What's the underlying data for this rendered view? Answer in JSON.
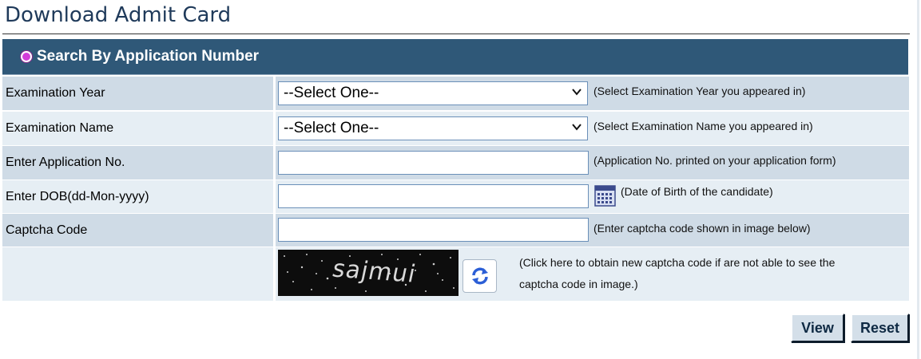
{
  "page": {
    "title": "Download Admit Card"
  },
  "search": {
    "title": "Search By Application Number",
    "rows": [
      {
        "label": "Examination Year",
        "value": "--Select One--",
        "hint": "(Select Examination Year you appeared in)"
      },
      {
        "label": "Examination Name",
        "value": "--Select One--",
        "hint": "(Select Examination Name you appeared in)"
      },
      {
        "label": "Enter Application No.",
        "value": "",
        "hint": "(Application No. printed on your application form)"
      },
      {
        "label": "Enter DOB(dd-Mon-yyyy)",
        "value": "",
        "hint": "(Date of Birth of the candidate)"
      },
      {
        "label": "Captcha Code",
        "value": "",
        "hint": "(Enter captcha code shown in image below)"
      }
    ],
    "captcha": {
      "text": "sajmui",
      "refresh_hint_line1": "(Click here to obtain new captcha code if are not able to see the",
      "refresh_hint_line2": "captcha code in image.)"
    }
  },
  "icons": {
    "calendar": "calendar-icon",
    "refresh": "refresh-icon",
    "radio": "radio-selected-icon",
    "dropdown": "chevron-down-icon"
  },
  "buttons": {
    "view": "View",
    "reset": "Reset"
  },
  "colors": {
    "header": "#2f5878",
    "row_dark": "#cfdbe6",
    "row_light": "#e6eef4",
    "radio": "#d33cd9"
  }
}
